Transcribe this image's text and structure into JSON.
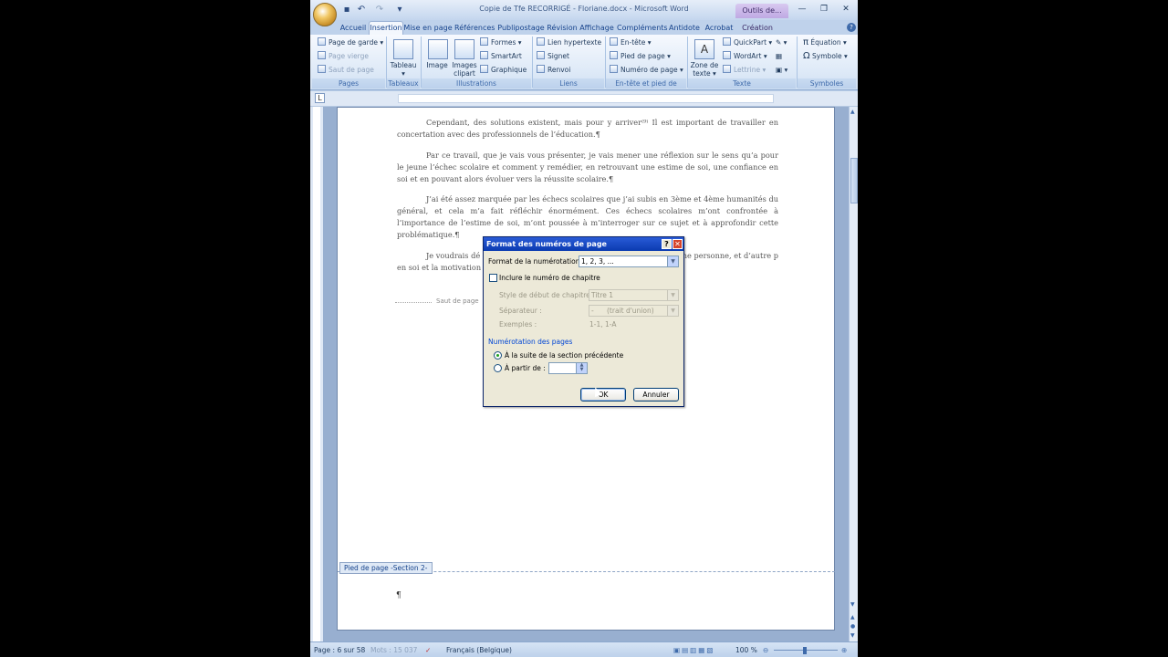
{
  "window": {
    "title": "Copie de Tfe RECORRIGÉ - Floriane.docx - Microsoft Word",
    "context_tab": "Outils de..."
  },
  "tabs": [
    "Accueil",
    "Insertion",
    "Mise en page",
    "Références",
    "Publipostage",
    "Révision",
    "Affichage",
    "Compléments",
    "Antidote",
    "Acrobat",
    "Création"
  ],
  "active_tab": "Insertion",
  "ribbon": {
    "pages": {
      "label": "Pages",
      "items": [
        "Page de garde",
        "Page vierge",
        "Saut de page"
      ]
    },
    "tableaux": {
      "label": "Tableaux",
      "button": "Tableau"
    },
    "illustrations": {
      "label": "Illustrations",
      "image": "Image",
      "clipart": "Images clipart",
      "items": [
        "Formes",
        "SmartArt",
        "Graphique"
      ]
    },
    "liens": {
      "label": "Liens",
      "items": [
        "Lien hypertexte",
        "Signet",
        "Renvoi"
      ]
    },
    "entete": {
      "label": "En-tête et pied de page",
      "items": [
        "En-tête",
        "Pied de page",
        "Numéro de page"
      ]
    },
    "texte": {
      "label": "Texte",
      "zone": "Zone de texte",
      "items": [
        "QuickPart",
        "WordArt",
        "Lettrine"
      ]
    },
    "symboles": {
      "label": "Symboles",
      "items": [
        "Équation",
        "Symbole"
      ]
    }
  },
  "document": {
    "paragraphs": [
      "Cependant, des solutions existent, mais pour y arriver⁽⁹⁾ Il est important de travailler en concertation avec des professionnels de l’éducation.¶",
      "Par ce travail, que je vais vous présenter, je vais mener une réflexion sur le sens qu’a pour le jeune l’échec scolaire et comment y remédier, en retrouvant une estime de soi, une confiance en soi et en pouvant alors évoluer vers la réussite scolaire.¶",
      "J’ai été assez marquée par les échecs scolaires que j’ai subis en 3ème et 4ème humanités du général, et cela m’a fait réfléchir énormément. Ces échecs scolaires m’ont confrontée à l’importance de l’estime de soi, m’ont poussée à m’interroger sur ce sujet et à approfondir cette problématique.¶",
      "Je voudrais dé                                                    échec scolaire sur une personne, et d’autre p                                                    en soi et la motivation qui sont probablem"
    ],
    "page_break": "Saut de page",
    "footer_tag": "Pied de page -Section 2-",
    "footer_mark": "¶"
  },
  "dialog": {
    "title": "Format des numéros de page",
    "help": "?",
    "close": "✕",
    "format_label": "Format de la numérotation :",
    "format_value": "1, 2, 3, ...",
    "include_chapter": "Inclure le numéro de chapitre",
    "chapter_style_label": "Style de début de chapitre :",
    "chapter_style_value": "Titre 1",
    "separator_label": "Séparateur :",
    "separator_value": "-      (trait d'union)",
    "examples_label": "Exemples :",
    "examples_value": "1-1, 1-A",
    "section_title": "Numérotation des pages",
    "radio_continue": "À la suite de la section précédente",
    "radio_start": "À partir de :",
    "start_value": "",
    "ok": "OK",
    "cancel": "Annuler"
  },
  "status": {
    "page": "Page : 6 sur 58",
    "words": "Mots : 15 037",
    "language": "Français (Belgique)",
    "zoom": "100 %"
  }
}
